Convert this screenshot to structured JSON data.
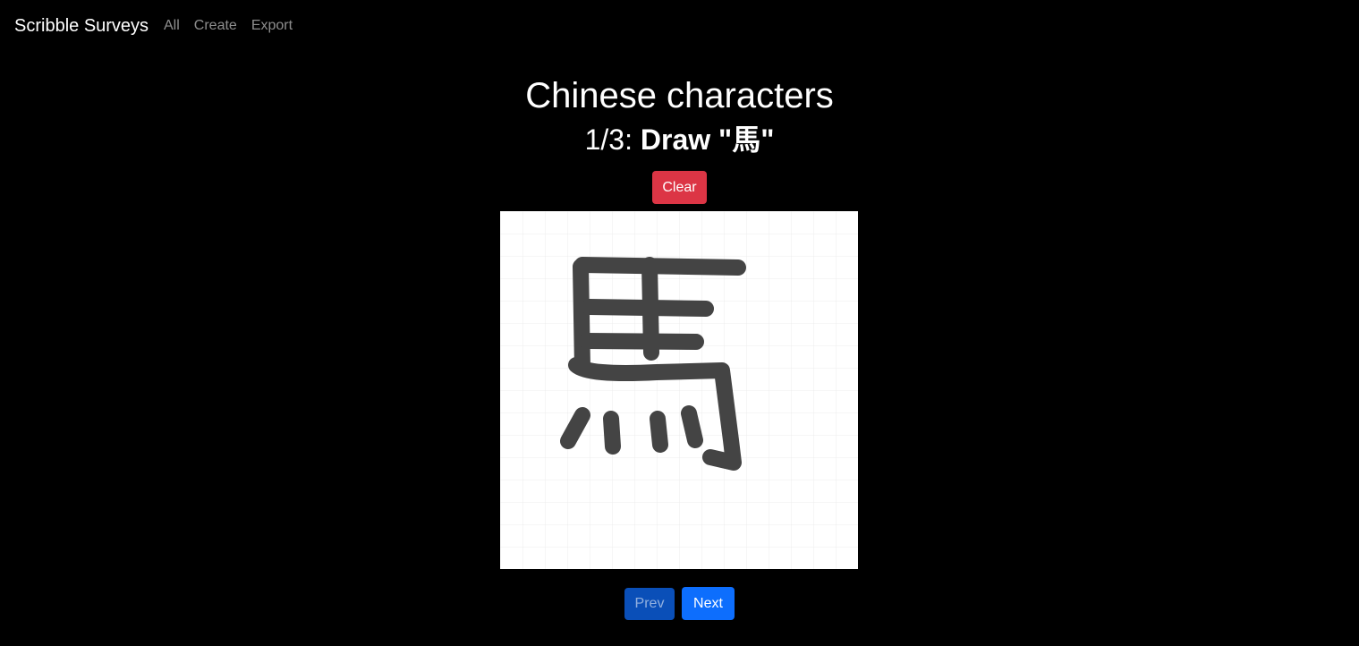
{
  "navbar": {
    "brand": "Scribble Surveys",
    "links": [
      {
        "label": "All"
      },
      {
        "label": "Create"
      },
      {
        "label": "Export"
      }
    ]
  },
  "survey": {
    "title": "Chinese characters",
    "progress": "1/3:",
    "prompt": "Draw \"馬\""
  },
  "actions": {
    "clear_label": "Clear",
    "prev_label": "Prev",
    "next_label": "Next"
  },
  "colors": {
    "background": "#000000",
    "clear_button": "#dc3545",
    "next_button": "#0d6efd",
    "prev_button_disabled": "#0a4fb8",
    "stroke": "#444444",
    "canvas": "#ffffff"
  }
}
